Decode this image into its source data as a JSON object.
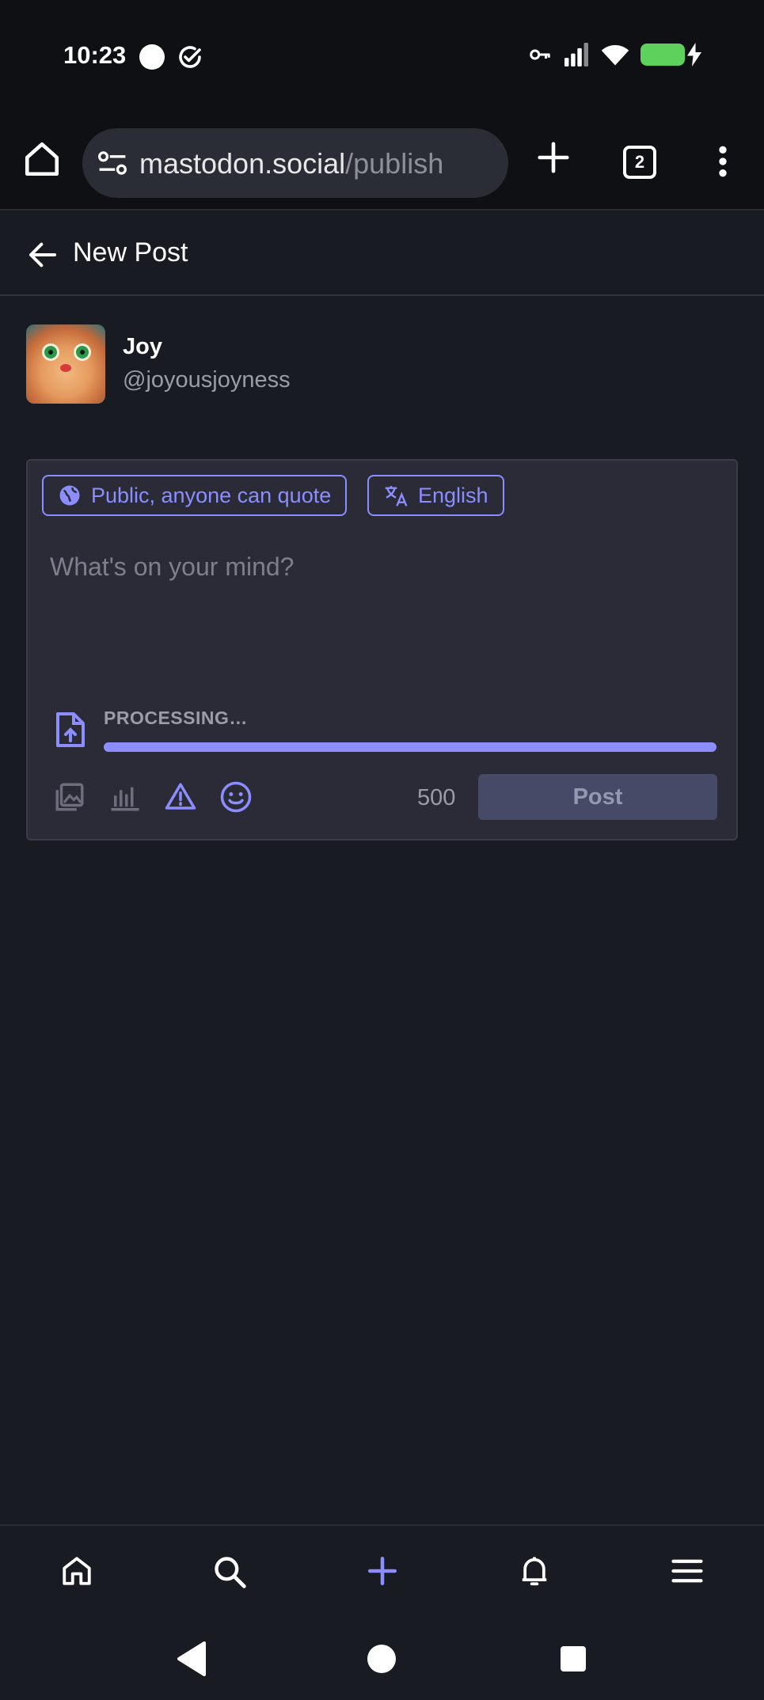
{
  "status_bar": {
    "time": "10:23"
  },
  "browser": {
    "url_host": "mastodon.social",
    "url_path": "/publish",
    "tab_count": "2"
  },
  "header": {
    "title": "New Post"
  },
  "account": {
    "display_name": "Joy",
    "handle": "@joyousjoyness"
  },
  "composer": {
    "visibility_label": "Public, anyone can quote",
    "language_label": "English",
    "placeholder": "What's on your mind?",
    "upload_status": "PROCESSING…",
    "upload_progress_percent": 100,
    "char_count": "500",
    "post_label": "Post",
    "accent_color": "#8c8dff"
  },
  "icons": {
    "status": [
      "circle-icon",
      "check-circle-icon",
      "key-icon",
      "signal-icon",
      "wifi-icon",
      "battery-charging-icon"
    ],
    "browser": [
      "home-icon",
      "site-settings-icon",
      "new-tab-plus-icon",
      "tabs-icon",
      "more-vert-icon"
    ],
    "toolbar": [
      "media-icon",
      "poll-icon",
      "warning-icon",
      "emoji-icon"
    ],
    "bottom_nav": [
      "home-icon",
      "search-icon",
      "compose-plus-icon",
      "notifications-bell-icon",
      "menu-icon"
    ],
    "system_nav": [
      "back-icon",
      "home-circle-icon",
      "recents-square-icon"
    ]
  }
}
